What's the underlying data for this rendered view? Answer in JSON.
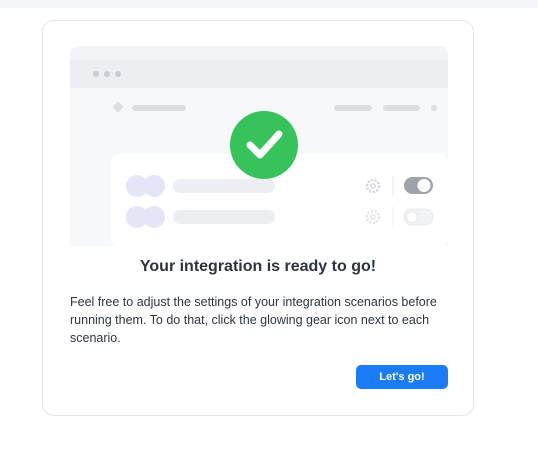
{
  "dialog": {
    "heading": "Your integration is ready to go!",
    "body": "Feel free to adjust the settings of your integration scenarios before running them. To do that, click the glowing gear icon next to each scenario.",
    "cta_label": "Let's go!"
  },
  "illustration": {
    "icons": [
      "check-circle-icon",
      "gear-icon",
      "toggle-switch-icon"
    ],
    "scenarios": [
      {
        "toggle_on": true
      },
      {
        "toggle_on": false
      }
    ]
  },
  "colors": {
    "accent": "#1a7cf6",
    "success": "#36c35a",
    "placeholder": "#eceef1",
    "avatar": "#e4e5f7"
  }
}
